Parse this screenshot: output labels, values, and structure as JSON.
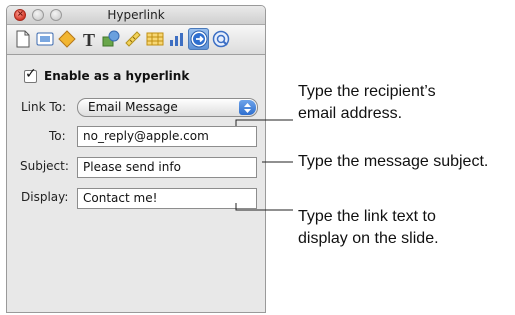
{
  "window": {
    "title": "Hyperlink"
  },
  "toolbar": {
    "tools": [
      "document-icon",
      "slide-icon",
      "build-icon",
      "text-icon",
      "graphic-icon",
      "metrics-icon",
      "table-icon",
      "chart-icon",
      "hyperlink-icon",
      "quicktime-icon"
    ],
    "active": "hyperlink-icon"
  },
  "hyperlink": {
    "enable_label": "Enable as a hyperlink",
    "enabled": true,
    "link_to_label": "Link To:",
    "link_to_value": "Email Message",
    "to_label": "To:",
    "to_value": "no_reply@apple.com",
    "subject_label": "Subject:",
    "subject_value": "Please send info",
    "display_label": "Display:",
    "display_value": "Contact me!"
  },
  "callouts": {
    "recipient_line1": "Type the recipient’s",
    "recipient_line2": "email address.",
    "subject": "Type the message subject.",
    "display_line1": "Type the link text to",
    "display_line2": "display on the slide."
  },
  "colors": {
    "selected_tool": "#5a8fd6",
    "close_button": "#d33a2b",
    "popup_arrows": "#2f6fcf"
  }
}
